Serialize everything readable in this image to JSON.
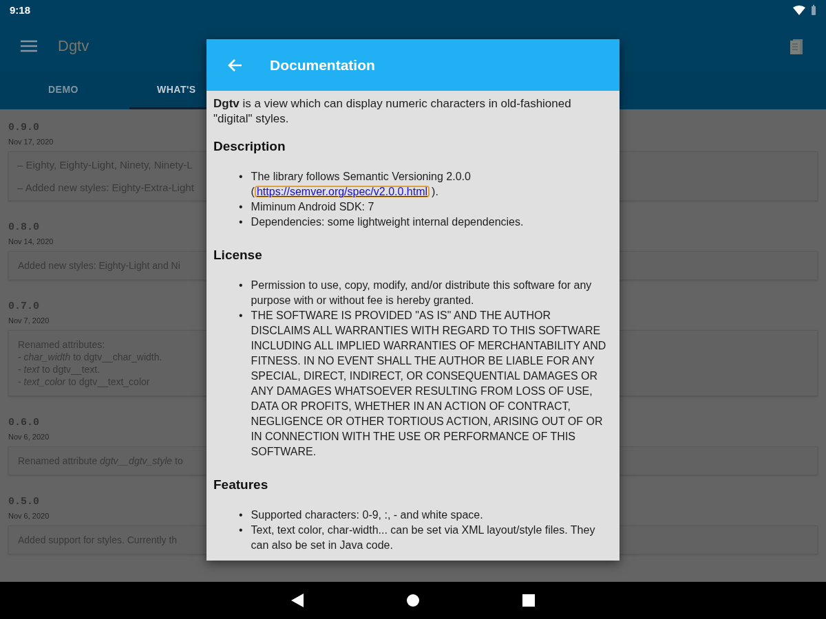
{
  "status_bar": {
    "time": "9:18"
  },
  "app_bar": {
    "title": "Dgtv"
  },
  "tabs": [
    {
      "label": "DEMO",
      "selected": false
    },
    {
      "label": "WHAT'S",
      "selected": true
    }
  ],
  "releases": [
    {
      "version": "0.9.0",
      "date": "Nov 17, 2020",
      "kind": "bullets",
      "lines": [
        "– Eighty, Eighty-Light, Ninety, Ninety-L",
        "– Added new styles: Eighty-Extra-Light"
      ]
    },
    {
      "version": "0.8.0",
      "date": "Nov 14, 2020",
      "kind": "plain",
      "lines": [
        "Added new styles: Eighty-Light and Ni"
      ]
    },
    {
      "version": "0.7.0",
      "date": "Nov 7, 2020",
      "kind": "plain",
      "lines": [
        "Renamed attributes:",
        "- *char_width* to dgtv__char_width.",
        "- *text* to dgtv__text.",
        "- *text_color* to dgtv__text_color"
      ]
    },
    {
      "version": "0.6.0",
      "date": "Nov 6, 2020",
      "kind": "plain",
      "lines": [
        "Renamed attribute *dgtv__dgtv_style* to"
      ]
    },
    {
      "version": "0.5.0",
      "date": "Nov 6, 2020",
      "kind": "plain",
      "lines": [
        "Added support for styles. Currently th"
      ]
    }
  ],
  "dialog": {
    "title": "Documentation",
    "intro": "**Dgtv** is a view which can display numeric characters in old-fashioned \"digital\" styles.",
    "bullet": "•",
    "sections": [
      {
        "heading": "Description",
        "items": [
          {
            "text": "The library follows Semantic Versioning 2.0.0 (",
            "link": "https://semver.org/spec/v2.0.0.html",
            "after": ")."
          },
          {
            "text": "Miminum Android SDK: 7"
          },
          {
            "text": "Dependencies: some lightweight internal dependencies."
          }
        ]
      },
      {
        "heading": "License",
        "items": [
          {
            "text": "Permission to use, copy, modify, and/or distribute this software for any purpose with or without fee is hereby granted."
          },
          {
            "text": "THE SOFTWARE IS PROVIDED \"AS IS\" AND THE AUTHOR DISCLAIMS ALL WARRANTIES WITH REGARD TO THIS SOFTWARE INCLUDING ALL IMPLIED WARRANTIES OF MERCHANTABILITY AND FITNESS. IN NO EVENT SHALL THE AUTHOR BE LIABLE FOR ANY SPECIAL, DIRECT, INDIRECT, OR CONSEQUENTIAL DAMAGES OR ANY DAMAGES WHATSOEVER RESULTING FROM LOSS OF USE, DATA OR PROFITS, WHETHER IN AN ACTION OF CONTRACT, NEGLIGENCE OR OTHER TORTIOUS ACTION, ARISING OUT OF OR IN CONNECTION WITH THE USE OR PERFORMANCE OF THIS SOFTWARE."
          }
        ]
      },
      {
        "heading": "Features",
        "items": [
          {
            "text": "Supported characters: 0-9, :, - and white space."
          },
          {
            "text": "Text, text color, char-width... can be set via XML layout/style files. They can also be set in Java code."
          }
        ]
      }
    ]
  }
}
